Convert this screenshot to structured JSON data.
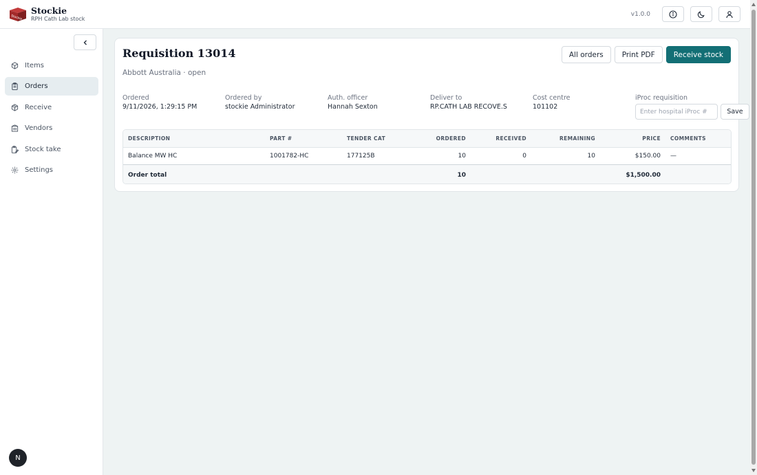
{
  "app": {
    "name": "Stockie",
    "subtitle": "RPH Cath Lab stock",
    "logo_text": "Stockie",
    "version": "v1.0.0"
  },
  "sidebar": {
    "items": [
      {
        "label": "Items",
        "icon": "box-icon",
        "active": false
      },
      {
        "label": "Orders",
        "icon": "clipboard-icon",
        "active": true
      },
      {
        "label": "Receive",
        "icon": "package-receive-icon",
        "active": false
      },
      {
        "label": "Vendors",
        "icon": "building-icon",
        "active": false
      },
      {
        "label": "Stock take",
        "icon": "clipboard-edit-icon",
        "active": false
      },
      {
        "label": "Settings",
        "icon": "gear-icon",
        "active": false
      }
    ],
    "badge": "N"
  },
  "page": {
    "title": "Requisition 13014",
    "subtitle": "Abbott Australia · open",
    "buttons": {
      "all_orders": "All orders",
      "print_pdf": "Print PDF",
      "receive_stock": "Receive stock"
    },
    "meta": {
      "ordered_label": "Ordered",
      "ordered_value": "9/11/2026, 1:29:15 PM",
      "ordered_by_label": "Ordered by",
      "ordered_by_value": "stockie Administrator",
      "auth_label": "Auth. officer",
      "auth_value": "Hannah Sexton",
      "deliver_label": "Deliver to",
      "deliver_value": "RP.CATH LAB RECOVE.S",
      "cost_label": "Cost centre",
      "cost_value": "101102",
      "iproc_label": "iProc requisition",
      "iproc_placeholder": "Enter hospital iProc #",
      "save": "Save"
    }
  },
  "table": {
    "headers": [
      "DESCRIPTION",
      "PART #",
      "TENDER CAT",
      "ORDERED",
      "RECEIVED",
      "REMAINING",
      "PRICE",
      "COMMENTS"
    ],
    "rows": [
      [
        "Balance MW HC",
        "1001782-HC",
        "177125B",
        "10",
        "0",
        "10",
        "$150.00",
        "—"
      ]
    ],
    "footer": {
      "label": "Order total",
      "ordered": "10",
      "price": "$1,500.00"
    }
  },
  "colors": {
    "accent": "#136f75",
    "active_nav": "#e6edf0",
    "background": "#eef3f3"
  }
}
